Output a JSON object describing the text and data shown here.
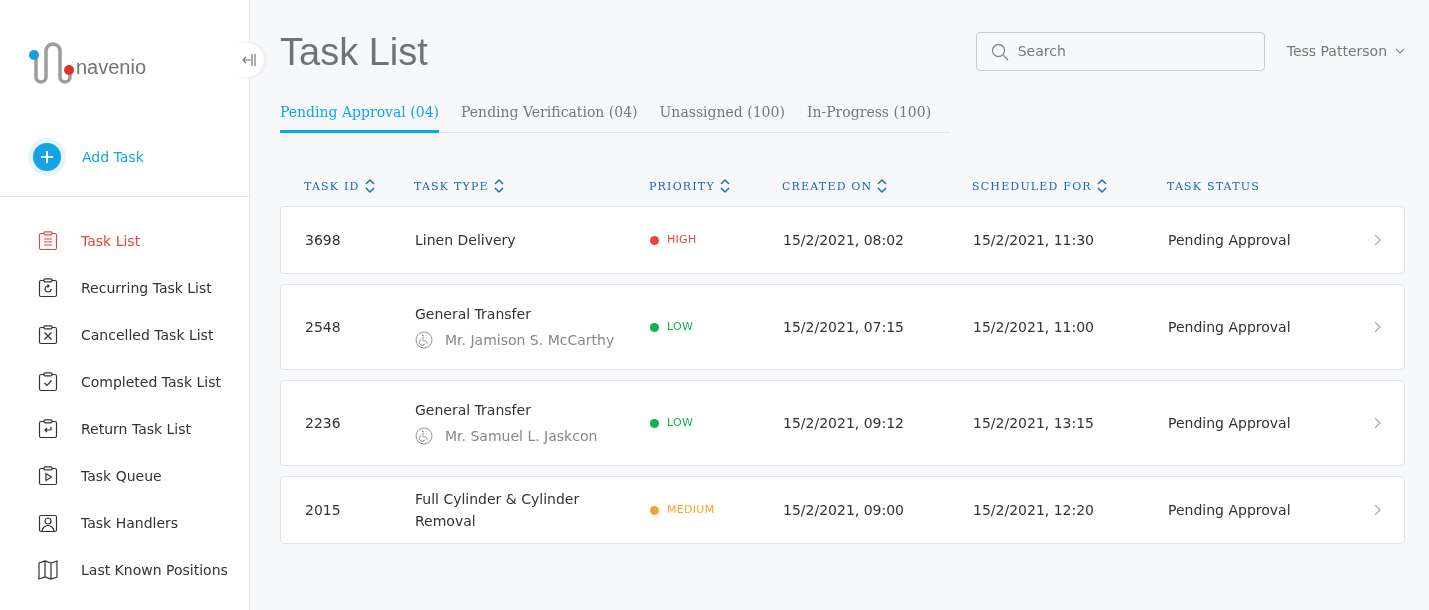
{
  "logo": {
    "text": "navenio"
  },
  "add_task": {
    "label": "Add Task"
  },
  "sidebar": {
    "items": [
      {
        "label": "Task List",
        "kind": "list",
        "selected": true
      },
      {
        "label": "Recurring Task List",
        "kind": "recurring",
        "selected": false
      },
      {
        "label": "Cancelled Task List",
        "kind": "cancelled",
        "selected": false
      },
      {
        "label": "Completed Task List",
        "kind": "completed",
        "selected": false
      },
      {
        "label": "Return Task List",
        "kind": "return",
        "selected": false
      },
      {
        "label": "Task Queue",
        "kind": "queue",
        "selected": false
      },
      {
        "label": "Task Handlers",
        "kind": "handlers",
        "selected": false
      },
      {
        "label": "Last Known Positions",
        "kind": "map",
        "selected": false
      }
    ]
  },
  "page": {
    "title": "Task List"
  },
  "search": {
    "placeholder": "Search"
  },
  "user": {
    "name": "Tess Patterson"
  },
  "tabs": [
    {
      "label": "Pending Approval (04)",
      "selected": true
    },
    {
      "label": "Pending Verification (04)",
      "selected": false
    },
    {
      "label": "Unassigned (100)",
      "selected": false
    },
    {
      "label": "In-Progress (100)",
      "selected": false
    }
  ],
  "table": {
    "columns": [
      {
        "label": "TASK ID",
        "sortable": true
      },
      {
        "label": "TASK TYPE",
        "sortable": true
      },
      {
        "label": "PRIORITY",
        "sortable": true
      },
      {
        "label": "CREATED ON",
        "sortable": true
      },
      {
        "label": "SCHEDULED FOR",
        "sortable": true
      },
      {
        "label": "TASK STATUS",
        "sortable": false
      }
    ],
    "rows": [
      {
        "id": "3698",
        "type": "Linen Delivery",
        "priority": "HIGH",
        "color": "#e8453c",
        "created": "15/2/2021, 08:02",
        "scheduled": "15/2/2021, 11:30",
        "status": "Pending Approval"
      },
      {
        "id": "2548",
        "type": "General Transfer",
        "patient": "Mr. Jamison S. McCarthy",
        "priority": "LOW",
        "color": "#12b04f",
        "created": "15/2/2021, 07:15",
        "scheduled": "15/2/2021, 11:00",
        "status": "Pending Approval"
      },
      {
        "id": "2236",
        "type": "General Transfer",
        "patient": "Mr. Samuel L. Jaskcon",
        "priority": "LOW",
        "color": "#12b04f",
        "created": "15/2/2021, 09:12",
        "scheduled": "15/2/2021, 13:15",
        "status": "Pending Approval"
      },
      {
        "id": "2015",
        "type": "Full Cylinder & Cylinder Removal",
        "priority": "MEDIUM",
        "color": "#f5a623",
        "created": "15/2/2021, 09:00",
        "scheduled": "15/2/2021, 12:20",
        "status": "Pending Approval"
      }
    ]
  }
}
